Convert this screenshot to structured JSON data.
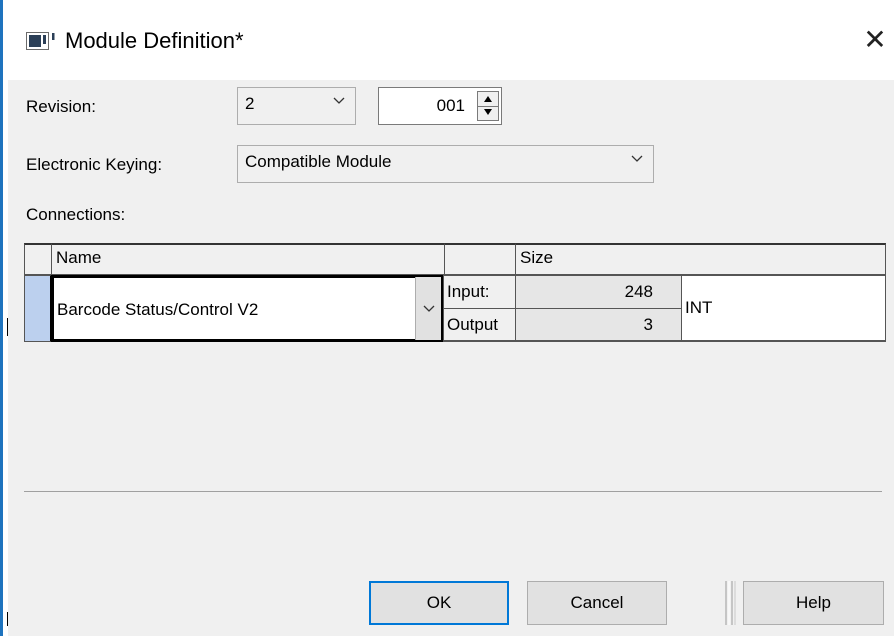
{
  "window": {
    "title": "Module Definition*",
    "close_symbol": "✕"
  },
  "revision": {
    "label": "Revision:",
    "major": "2",
    "minor": "001"
  },
  "keying": {
    "label": "Electronic Keying:",
    "value": "Compatible Module"
  },
  "connections": {
    "label": "Connections:",
    "headers": {
      "name": "Name",
      "size": "Size"
    },
    "row": {
      "name": "Barcode Status/Control V2",
      "input_label": "Input:",
      "input_size": "248",
      "output_label": "Output",
      "output_size": "3",
      "type": "INT"
    }
  },
  "buttons": {
    "ok": "OK",
    "cancel": "Cancel",
    "help": "Help"
  },
  "colors": {
    "accent": "#0078d7",
    "selection": "#bcd0ee",
    "dialog_bg": "#f0f0f0"
  }
}
